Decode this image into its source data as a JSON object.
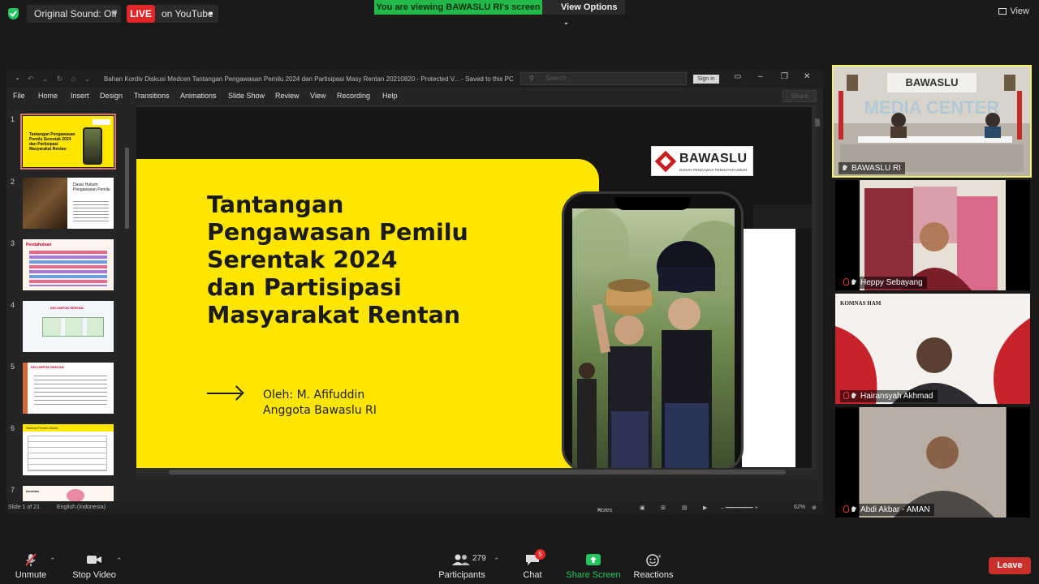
{
  "zoom": {
    "original_sound_label": "Original Sound: Off",
    "live_label": "LIVE",
    "live_destination": "on YouTube",
    "viewing_banner": "You are viewing BAWASLU RI's screen",
    "view_options_label": "View Options",
    "view_label": "View",
    "toolbar": {
      "unmute": "Unmute",
      "stop_video": "Stop Video",
      "participants": "Participants",
      "participants_count": "279",
      "chat": "Chat",
      "chat_badge": "5",
      "share_screen": "Share Screen",
      "reactions": "Reactions",
      "leave": "Leave"
    },
    "participants_tiles": [
      {
        "name": "BAWASLU RI"
      },
      {
        "name": "Heppy Sebayang"
      },
      {
        "name": "Hairansyah Akhmad"
      },
      {
        "name": "Abdi Akbar - AMAN"
      }
    ],
    "colors": {
      "live": "#e02828",
      "share": "#22b84a",
      "leave": "#c9302c",
      "active_speaker": "#f3f06a"
    }
  },
  "powerpoint": {
    "doc_title": "Bahan Kordiv Diskusi Medcen Tantangan Pengawasan Pemilu 2024 dan Partisipasi Masy Rentan 20210820  -  Protected V...  -  Saved to this PC",
    "search_placeholder": "Search",
    "sign_in": "Sign in",
    "share": "Share",
    "menu": [
      "File",
      "Home",
      "Insert",
      "Design",
      "Transitions",
      "Animations",
      "Slide Show",
      "Review",
      "View",
      "Recording",
      "Help"
    ],
    "status": {
      "slide_of": "Slide 1 of 21",
      "language": "English (Indonesia)",
      "notes": "Notes",
      "zoom": "62%"
    },
    "thumbnails": [
      {
        "num": "1",
        "title": "Tantangan Pengawasan Pemilu Serentak 2024 dan Partisipasi Masyarakat Rentan"
      },
      {
        "num": "2",
        "title": "Dasar Hukum Pengawasan Pemilu"
      },
      {
        "num": "3",
        "title": "Pendahuluan"
      },
      {
        "num": "4",
        "title": "KELOMPOK RENTAN"
      },
      {
        "num": "5",
        "title": "KELOMPOK RENTAN"
      },
      {
        "num": "6",
        "title": "Standar Pemilu Akses"
      },
      {
        "num": "7",
        "title": "Identitas"
      }
    ]
  },
  "slide": {
    "title_lines": [
      "Tantangan",
      "Pengawasan Pemilu",
      "Serentak 2024",
      "dan Partisipasi",
      "Masyarakat Rentan"
    ],
    "byline_1": "Oleh: M. Afifuddin",
    "byline_2": "Anggota Bawaslu RI",
    "logo_text": "BAWASLU",
    "logo_subtext": "BADAN PENGAWAS PEMILIHAN UMUM",
    "accent": "#ffe600"
  }
}
